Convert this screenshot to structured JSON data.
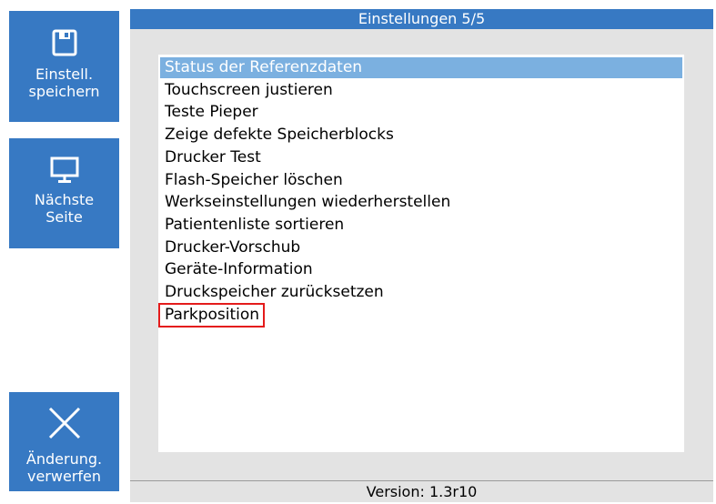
{
  "sidebar": {
    "save": {
      "label_line1": "Einstell.",
      "label_line2": "speichern",
      "icon": "floppy-disk-icon"
    },
    "next": {
      "label_line1": "Nächste",
      "label_line2": "Seite",
      "icon": "monitor-icon"
    },
    "discard": {
      "label_line1": "Änderung.",
      "label_line2": "verwerfen",
      "icon": "close-icon"
    }
  },
  "panel": {
    "title": "Einstellungen 5/5",
    "items": [
      {
        "label": "Status der Referenzdaten"
      },
      {
        "label": "Touchscreen justieren"
      },
      {
        "label": "Teste Pieper"
      },
      {
        "label": "Zeige defekte Speicherblocks"
      },
      {
        "label": "Drucker Test"
      },
      {
        "label": "Flash-Speicher löschen"
      },
      {
        "label": "Werkseinstellungen wiederherstellen"
      },
      {
        "label": "Patientenliste sortieren"
      },
      {
        "label": "Drucker-Vorschub"
      },
      {
        "label": "Geräte-Information"
      },
      {
        "label": "Druckspeicher zurücksetzen"
      },
      {
        "label": "Parkposition"
      }
    ],
    "selected_index": 0,
    "highlighted_index": 11,
    "version": "Version: 1.3r10"
  },
  "colors": {
    "accent": "#3779c3",
    "selection": "#7bb0e0",
    "highlight_border": "#e41b1b",
    "panel_bg": "#e3e3e3"
  }
}
